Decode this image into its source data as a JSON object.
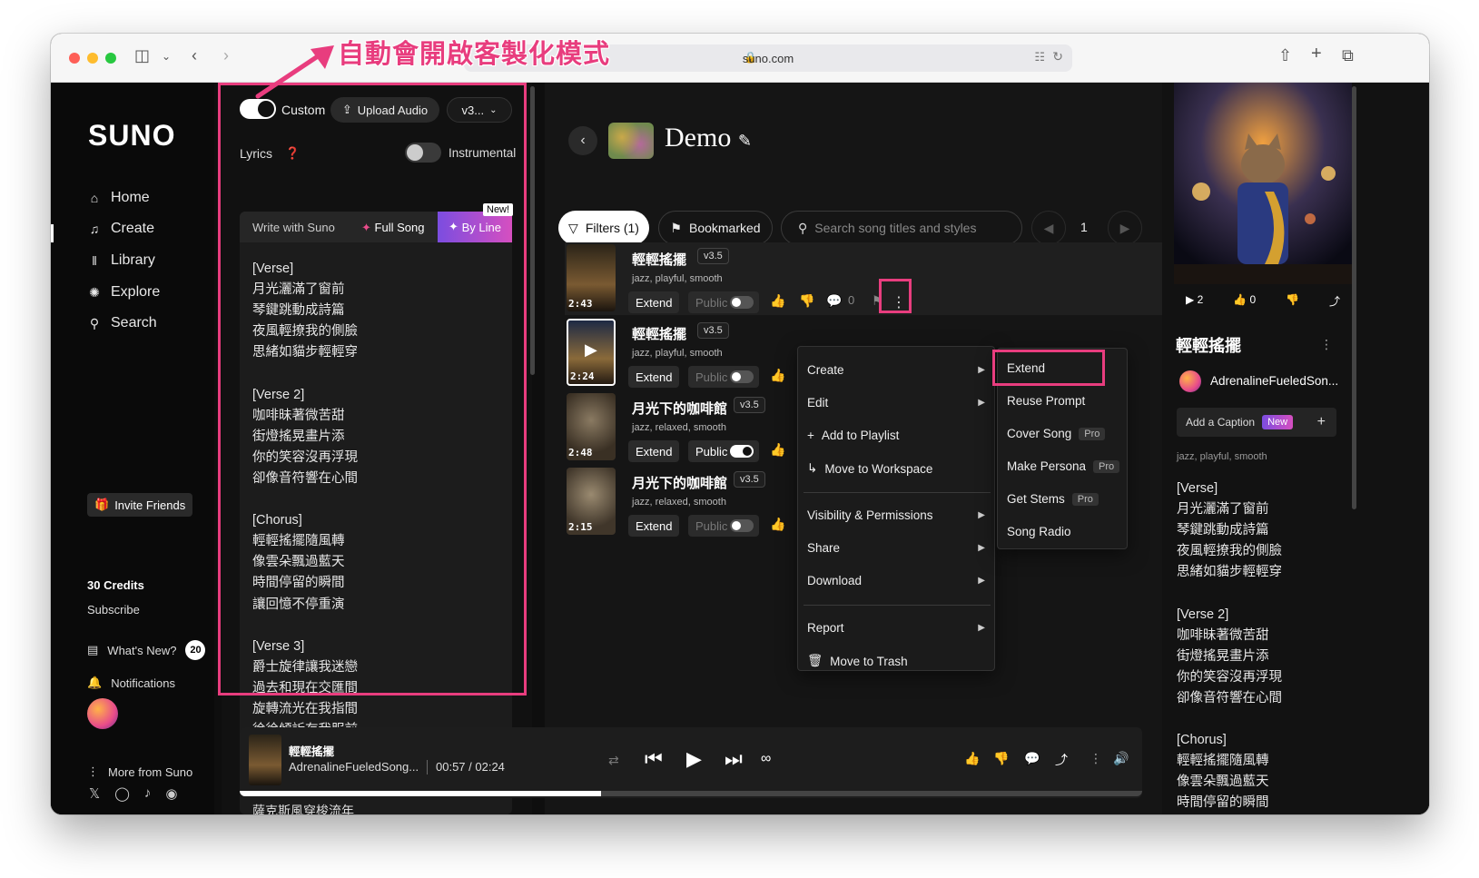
{
  "browser": {
    "url": "suno.com"
  },
  "sidebar": {
    "logo": "SUNO",
    "nav": [
      {
        "label": "Home",
        "icon": "home-icon"
      },
      {
        "label": "Create",
        "icon": "music-note-icon"
      },
      {
        "label": "Library",
        "icon": "library-icon"
      },
      {
        "label": "Explore",
        "icon": "compass-icon"
      },
      {
        "label": "Search",
        "icon": "search-icon"
      }
    ],
    "invite": "Invite Friends",
    "credits": "30 Credits",
    "subscribe": "Subscribe",
    "whats_new": "What's New?",
    "whats_new_count": "20",
    "notifications": "Notifications",
    "more": "More from Suno"
  },
  "create": {
    "custom_label": "Custom",
    "custom_on": true,
    "upload": "Upload Audio",
    "model": "v3...",
    "lyrics_label": "Lyrics",
    "instrumental_label": "Instrumental",
    "instrumental_on": false,
    "tabs": {
      "write": "Write with Suno",
      "full_song": "Full Song",
      "by_line": "By Line",
      "new_tag": "New!"
    },
    "lyrics": "[Verse]\n月光灑滿了窗前\n琴鍵跳動成詩篇\n夜風輕撩我的側臉\n思緒如貓步輕輕穿\n\n[Verse 2]\n咖啡昧著微苦甜\n街燈搖晃畫片添\n你的笑容沒再浮現\n卻像音符響在心間\n\n[Chorus]\n輕輕搖擺隨風轉\n像雲朵飄過藍天\n時間停留的瞬間\n讓回憶不停重演\n\n[Verse 3]\n爵士旋律讓我迷戀\n過去和現在交匯間\n旋轉流光在我指間\n徐徐傾訴存我服前",
    "lyrics_tail": "薩克斯風穿梭流年"
  },
  "workspace": {
    "title": "Demo",
    "filters": "Filters (1)",
    "bookmarked": "Bookmarked",
    "search_placeholder": "Search song titles and styles",
    "page": "1"
  },
  "songs": [
    {
      "title": "輕輕搖擺",
      "version": "v3.5",
      "tags": "jazz, playful, smooth",
      "duration": "2:43",
      "extend": "Extend",
      "visibility": "Public",
      "public_on": false,
      "comments": "0"
    },
    {
      "title": "輕輕搖擺",
      "version": "v3.5",
      "tags": "jazz, playful, smooth",
      "duration": "2:24",
      "extend": "Extend",
      "visibility": "Public",
      "public_on": false
    },
    {
      "title": "月光下的咖啡館",
      "version": "v3.5",
      "tags": "jazz, relaxed, smooth",
      "duration": "2:48",
      "extend": "Extend",
      "visibility": "Public",
      "public_on": true
    },
    {
      "title": "月光下的咖啡館",
      "version": "v3.5",
      "tags": "jazz, relaxed, smooth",
      "duration": "2:15",
      "extend": "Extend",
      "visibility": "Public",
      "public_on": false
    }
  ],
  "context_menu": {
    "items": [
      "Create",
      "Edit",
      "Add to Playlist",
      "Move to Workspace",
      "Visibility & Permissions",
      "Share",
      "Download",
      "Report",
      "Move to Trash"
    ]
  },
  "submenu": {
    "items": [
      "Extend",
      "Reuse Prompt",
      "Cover Song",
      "Make Persona",
      "Get Stems",
      "Song Radio"
    ],
    "pro_label": "Pro"
  },
  "now_playing": {
    "plays": "2",
    "likes": "0",
    "title": "輕輕搖擺",
    "artist": "AdrenalineFueledSon...",
    "caption": "Add a Caption",
    "caption_new": "New",
    "tags": "jazz, playful, smooth",
    "lyrics": "[Verse]\n月光灑滿了窗前\n琴鍵跳動成詩篇\n夜風輕撩我的側臉\n思緒如貓步輕輕穿\n\n[Verse 2]\n咖啡昧著微苦甜\n街燈搖晃畫片添\n你的笑容沒再浮現\n卻像音符響在心間\n\n[Chorus]\n輕輕搖擺隨風轉\n像雲朵飄過藍天\n時間停留的瞬間"
  },
  "player": {
    "title": "輕輕搖擺",
    "artist": "AdrenalineFueledSong...",
    "time": "00:57 / 02:24",
    "progress": 0.4
  },
  "annotation": {
    "text": "自動會開啟客製化模式",
    "color": "#e83d7e"
  },
  "colors": {
    "accent_gradient_start": "#7b4de0",
    "accent_gradient_end": "#d64fc0"
  }
}
